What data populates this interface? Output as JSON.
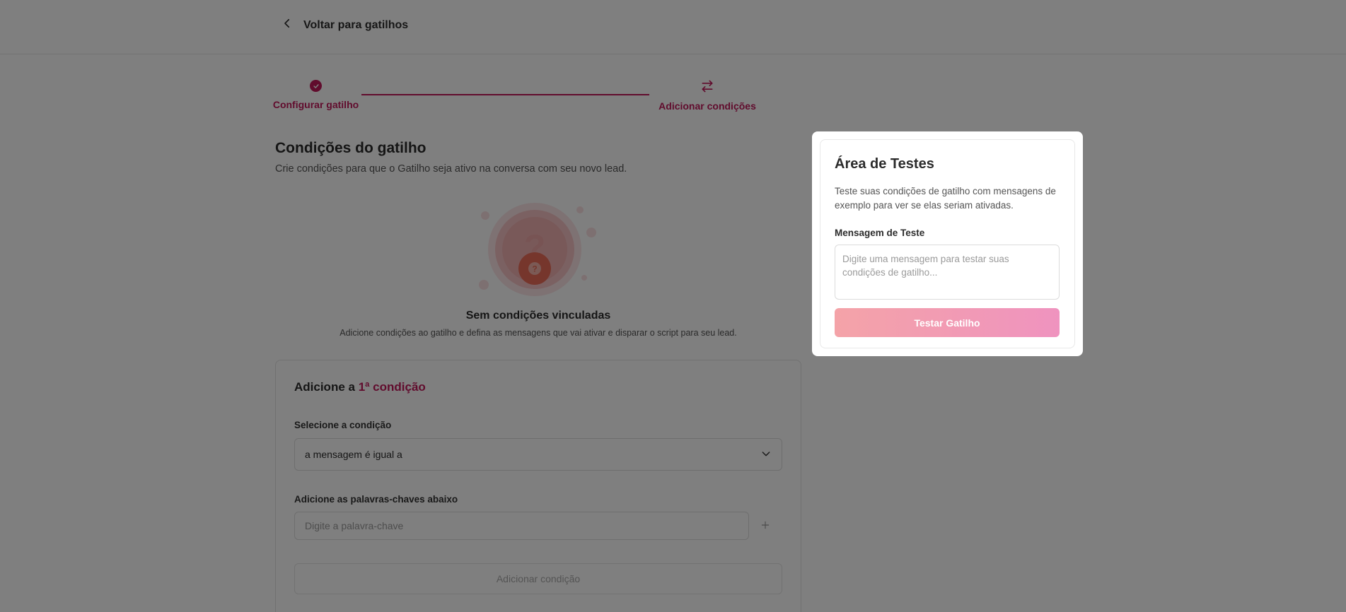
{
  "header": {
    "back_label": "Voltar para gatilhos"
  },
  "stepper": {
    "steps": [
      {
        "label": "Configurar gatilho",
        "status": "completed",
        "icon": "check-icon"
      },
      {
        "label": "Adicionar condições",
        "status": "current",
        "icon": "swap-arrows-icon"
      }
    ]
  },
  "conditions": {
    "title": "Condições do gatilho",
    "description": "Crie condições para que o Gatilho seja ativo na conversa com seu novo lead.",
    "empty_state": {
      "title": "Sem condições vinculadas",
      "description": "Adicione condições ao gatilho e defina as mensagens que vai ativar e disparar o script para seu lead.",
      "icon": "question-icon"
    }
  },
  "condition_form": {
    "heading_prefix": "Adicione a",
    "heading_accent": "1ª condição",
    "select_label": "Selecione a condição",
    "select_value": "a mensagem é igual a",
    "keywords_label": "Adicione as palavras-chaves abaixo",
    "keyword_placeholder": "Digite a palavra-chave",
    "add_button": "Adicionar condição"
  },
  "test_modal": {
    "title": "Área de Testes",
    "description": "Teste suas condições de gatilho com mensagens de exemplo para ver se elas seriam ativadas.",
    "field_label": "Mensagem de Teste",
    "placeholder": "Digite uma mensagem para testar suas condições de gatilho...",
    "button": "Testar Gatilho"
  },
  "colors": {
    "accent": "#c2185b",
    "overlay": "rgba(0,0,0,0.5)",
    "button_gradient_start": "#f4a3a8",
    "button_gradient_end": "#ef93bf"
  }
}
